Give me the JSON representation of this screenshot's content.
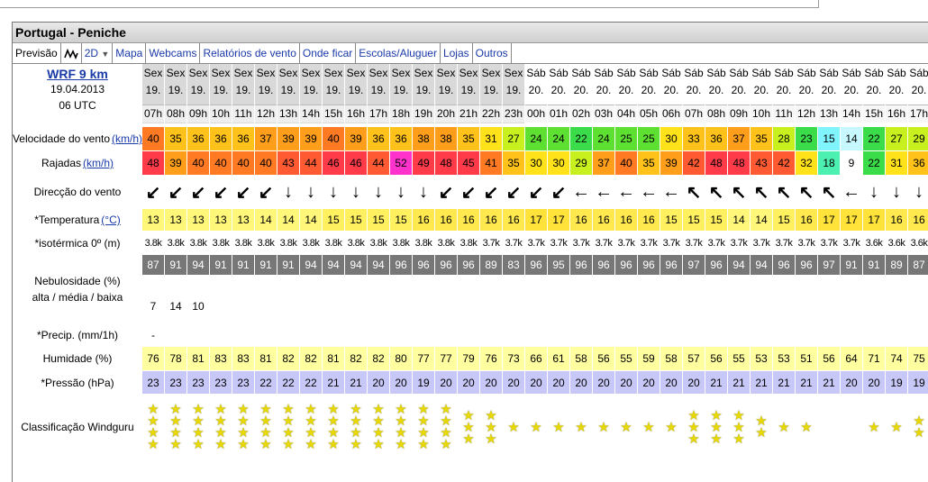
{
  "title": "Portugal - Peniche",
  "tabs": [
    "Previsão",
    "2D",
    "Mapa",
    "Webcams",
    "Relatórios de vento",
    "Onde ficar",
    "Escolas/Aluguer",
    "Lojas",
    "Outros"
  ],
  "model": {
    "name": "WRF 9 km",
    "date": "19.04.2013",
    "run": "06 UTC"
  },
  "labels": {
    "wind": "Velocidade do vento",
    "wind_unit": "(km/h)",
    "gusts": "Rajadas",
    "gusts_unit": "(km/h)",
    "direction": "Direcção do vento",
    "temp": "*Temperatura",
    "temp_unit": "(°C)",
    "iso": "*isotérmica 0º (m)",
    "cloud": "Nebulosidade (%)",
    "cloud_sub": "alta / média / baixa",
    "precip": "*Precip. (mm/1h)",
    "humidity": "Humidade (%)",
    "pressure": "*Pressão (hPa)",
    "rating": "Classificação Windguru"
  },
  "days": [
    "Sex",
    "Sex",
    "Sex",
    "Sex",
    "Sex",
    "Sex",
    "Sex",
    "Sex",
    "Sex",
    "Sex",
    "Sex",
    "Sex",
    "Sex",
    "Sex",
    "Sex",
    "Sex",
    "Sex",
    "Sáb",
    "Sáb",
    "Sáb",
    "Sáb",
    "Sáb",
    "Sáb",
    "Sáb",
    "Sáb",
    "Sáb",
    "Sáb",
    "Sáb",
    "Sáb",
    "Sáb",
    "Sáb",
    "Sáb",
    "Sáb",
    "Sáb",
    "Sáb"
  ],
  "dates": [
    "19.",
    "19.",
    "19.",
    "19.",
    "19.",
    "19.",
    "19.",
    "19.",
    "19.",
    "19.",
    "19.",
    "19.",
    "19.",
    "19.",
    "19.",
    "19.",
    "19.",
    "20.",
    "20.",
    "20.",
    "20.",
    "20.",
    "20.",
    "20.",
    "20.",
    "20.",
    "20.",
    "20.",
    "20.",
    "20.",
    "20.",
    "20.",
    "20.",
    "20.",
    "20."
  ],
  "hours": [
    "07h",
    "08h",
    "09h",
    "10h",
    "11h",
    "12h",
    "13h",
    "14h",
    "15h",
    "16h",
    "17h",
    "18h",
    "19h",
    "20h",
    "21h",
    "22h",
    "23h",
    "00h",
    "01h",
    "02h",
    "03h",
    "04h",
    "05h",
    "06h",
    "07h",
    "08h",
    "09h",
    "10h",
    "11h",
    "12h",
    "13h",
    "14h",
    "15h",
    "16h",
    "17h"
  ],
  "wind": [
    "40",
    "35",
    "36",
    "36",
    "36",
    "37",
    "39",
    "39",
    "40",
    "39",
    "36",
    "36",
    "38",
    "38",
    "35",
    "31",
    "27",
    "24",
    "24",
    "22",
    "24",
    "25",
    "25",
    "30",
    "33",
    "36",
    "37",
    "35",
    "28",
    "23",
    "15",
    "14",
    "22",
    "27",
    "29"
  ],
  "gusts": [
    "48",
    "39",
    "40",
    "40",
    "40",
    "40",
    "43",
    "44",
    "46",
    "46",
    "44",
    "52",
    "49",
    "48",
    "45",
    "41",
    "35",
    "30",
    "30",
    "29",
    "37",
    "40",
    "35",
    "39",
    "42",
    "48",
    "48",
    "43",
    "42",
    "32",
    "18",
    "9",
    "22",
    "31",
    "36"
  ],
  "direction": [
    "↙",
    "↙",
    "↙",
    "↙",
    "↙",
    "↙",
    "↓",
    "↓",
    "↓",
    "↓",
    "↓",
    "↓",
    "↓",
    "↙",
    "↙",
    "↙",
    "↙",
    "↙",
    "↙",
    "←",
    "←",
    "←",
    "←",
    "←",
    "↖",
    "↖",
    "↖",
    "↖",
    "↖",
    "↖",
    "↖",
    "←",
    "↓",
    "↓",
    "↓"
  ],
  "temp": [
    "13",
    "13",
    "13",
    "13",
    "13",
    "14",
    "14",
    "14",
    "15",
    "15",
    "15",
    "15",
    "16",
    "16",
    "16",
    "16",
    "16",
    "17",
    "17",
    "16",
    "16",
    "16",
    "16",
    "15",
    "15",
    "15",
    "14",
    "14",
    "15",
    "16",
    "17",
    "17",
    "17",
    "16",
    "16"
  ],
  "iso": [
    "3.8k",
    "3.8k",
    "3.8k",
    "3.8k",
    "3.8k",
    "3.8k",
    "3.8k",
    "3.8k",
    "3.8k",
    "3.8k",
    "3.8k",
    "3.8k",
    "3.8k",
    "3.8k",
    "3.8k",
    "3.7k",
    "3.7k",
    "3.7k",
    "3.7k",
    "3.7k",
    "3.7k",
    "3.7k",
    "3.7k",
    "3.7k",
    "3.7k",
    "3.7k",
    "3.7k",
    "3.7k",
    "3.7k",
    "3.7k",
    "3.7k",
    "3.7k",
    "3.6k",
    "3.6k",
    "3.6k"
  ],
  "cloud_high": [
    "87",
    "91",
    "94",
    "91",
    "91",
    "91",
    "91",
    "94",
    "94",
    "94",
    "94",
    "96",
    "96",
    "96",
    "96",
    "89",
    "83",
    "96",
    "95",
    "96",
    "96",
    "96",
    "96",
    "96",
    "97",
    "96",
    "94",
    "94",
    "96",
    "96",
    "97",
    "91",
    "91",
    "89",
    "87"
  ],
  "cloud_mid": [
    "",
    "",
    "",
    "",
    "",
    "",
    "",
    "",
    "",
    "",
    "",
    "",
    "",
    "",
    "",
    "",
    "",
    "",
    "",
    "",
    "",
    "",
    "",
    "",
    "",
    "",
    "",
    "",
    "",
    "",
    "",
    "",
    "",
    "",
    ""
  ],
  "cloud_low": [
    "7",
    "14",
    "10",
    "",
    "",
    "",
    "",
    "",
    "",
    "",
    "",
    "",
    "",
    "",
    "",
    "",
    "",
    "",
    "",
    "",
    "",
    "",
    "",
    "",
    "",
    "",
    "",
    "",
    "",
    "",
    "",
    "",
    "",
    "",
    ""
  ],
  "precip": [
    "-",
    "",
    "",
    "",
    "",
    "",
    "",
    "",
    "",
    "",
    "",
    "",
    "",
    "",
    "",
    "",
    "",
    "",
    "",
    "",
    "",
    "",
    "",
    "",
    "",
    "",
    "",
    "",
    "",
    "",
    "",
    "",
    "",
    "",
    ""
  ],
  "humidity": [
    "76",
    "78",
    "81",
    "83",
    "83",
    "81",
    "82",
    "82",
    "81",
    "82",
    "82",
    "80",
    "77",
    "77",
    "79",
    "76",
    "73",
    "66",
    "61",
    "58",
    "56",
    "55",
    "59",
    "58",
    "57",
    "56",
    "55",
    "53",
    "53",
    "51",
    "56",
    "64",
    "71",
    "74",
    "75"
  ],
  "pressure": [
    "23",
    "23",
    "23",
    "23",
    "23",
    "22",
    "22",
    "22",
    "21",
    "21",
    "20",
    "20",
    "19",
    "20",
    "20",
    "20",
    "20",
    "20",
    "20",
    "20",
    "20",
    "20",
    "20",
    "20",
    "20",
    "21",
    "21",
    "21",
    "21",
    "21",
    "21",
    "20",
    "20",
    "19",
    "19"
  ],
  "stars": [
    4,
    4,
    4,
    4,
    4,
    4,
    4,
    4,
    4,
    4,
    4,
    4,
    4,
    4,
    3,
    3,
    1,
    1,
    1,
    1,
    1,
    1,
    1,
    1,
    3,
    3,
    3,
    2,
    1,
    1,
    0,
    0,
    1,
    1,
    2
  ],
  "colors": {
    "link": "#1a3aa8",
    "star": "#e6d800",
    "temp_bg": "#fff06a",
    "humidity_bg": "#ffffa0",
    "pressure_bg": "#c8c8f8",
    "cloud_bg": "#777777"
  }
}
